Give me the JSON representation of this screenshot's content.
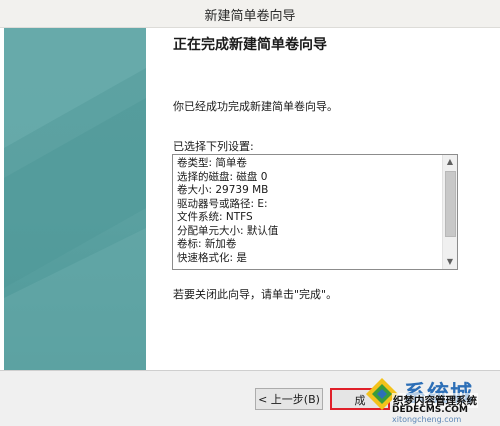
{
  "window": {
    "title": "新建简单卷向导"
  },
  "wizard": {
    "heading": "正在完成新建简单卷向导",
    "intro": "你已经成功完成新建简单卷向导。",
    "list_label": "已选择下列设置:",
    "settings": [
      "卷类型: 简单卷",
      "选择的磁盘: 磁盘 0",
      "卷大小: 29739 MB",
      "驱动器号或路径: E:",
      "文件系统: NTFS",
      "分配单元大小: 默认值",
      "卷标: 新加卷",
      "快速格式化: 是"
    ],
    "closing": "若要关闭此向导，请单击\"完成\"。"
  },
  "buttons": {
    "back_label": "< 上一步(B)",
    "finish_label": "成"
  },
  "watermark": {
    "big_text": "系统城",
    "mid_text": "织梦内容管理系统",
    "small_text": "DEDECMS.COM",
    "url_text": "xitongcheng.com"
  },
  "colors": {
    "side_panel": "#5ea3a3",
    "finish_highlight": "#e0202a",
    "watermark_blue": "#2d6fb7"
  },
  "icons": {
    "scroll_up": "▲",
    "scroll_down": "▼"
  }
}
